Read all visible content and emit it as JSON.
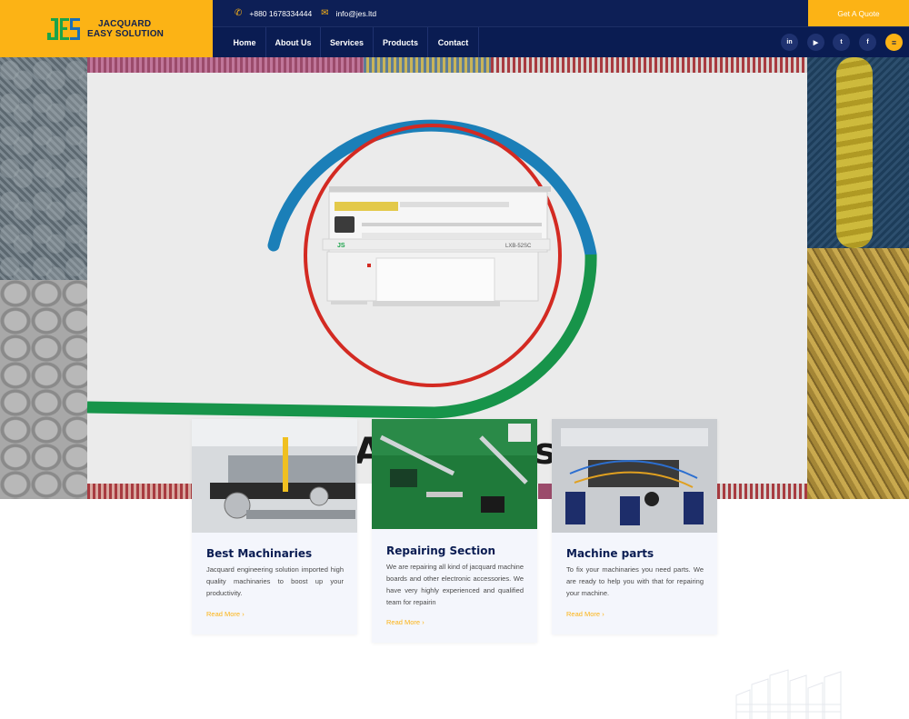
{
  "brand": {
    "line1": "JACQUARD",
    "line2": "EASY SOLUTION",
    "logo_colors": {
      "green": "#1aa34a",
      "blue": "#1b6fb8",
      "yellow": "#fcb315"
    }
  },
  "topbar": {
    "phone": "+880 1678334444",
    "email": "info@jes.ltd",
    "quote_label": "Get A Quote"
  },
  "nav": {
    "items": [
      "Home",
      "About Us",
      "Services",
      "Products",
      "Contact"
    ]
  },
  "social": {
    "icons": [
      "linkedin-icon",
      "youtube-icon",
      "twitter-icon",
      "facebook-icon",
      "menu-icon"
    ],
    "glyphs": [
      "in",
      "▶",
      "t",
      "f",
      "≡"
    ]
  },
  "hero": {
    "machine_label": "LXB-52SC",
    "machine_badge": "JS",
    "ring_colors": {
      "blue": "#1b7fb8",
      "green": "#17944a",
      "red": "#d32a22"
    },
    "background_word_left": "A",
    "background_word_right": "s"
  },
  "cards": [
    {
      "title": "Best Machinaries",
      "text": "Jacquard engineering solution imported high quality machinaries to boost up your productivity.",
      "link": "Read More"
    },
    {
      "title": "Repairing Section",
      "text": "We are repairing all kind of jacquard machine boards and other electronic accessories. We have very highly experienced and qualified team for repairin",
      "link": "Read More"
    },
    {
      "title": "Machine parts",
      "text": "To fix your machinaries you need parts. We are ready to help you with that for repairing your machine.",
      "link": "Read More"
    }
  ],
  "colors": {
    "navy": "#0a1c52",
    "accent": "#fcb315"
  }
}
